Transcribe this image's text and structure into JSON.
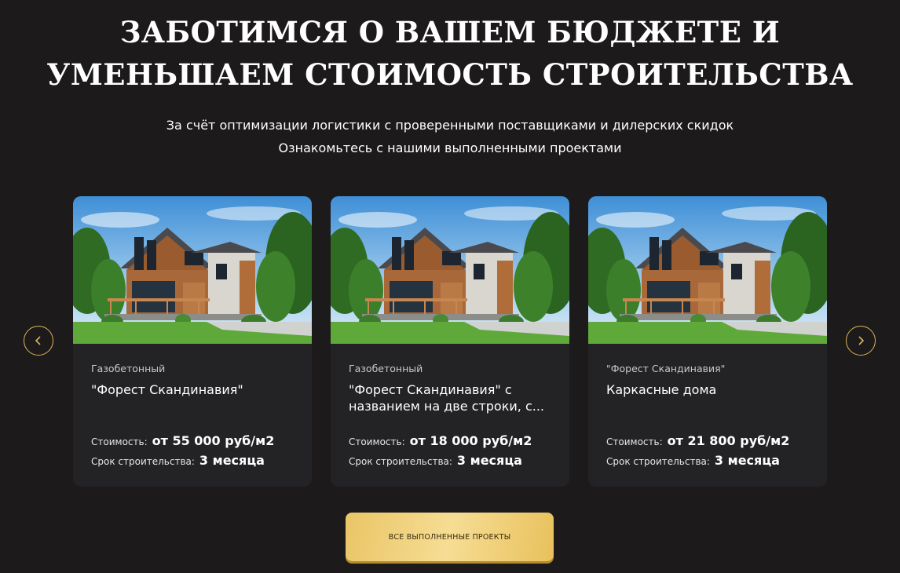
{
  "header": {
    "title_line1": "ЗАБОТИМСЯ О ВАШЕМ БЮДЖЕТЕ И",
    "title_line2": "УМЕНЬШАЕМ СТОИМОСТЬ СТРОИТЕЛЬСТВА",
    "subtitle_line1": "За счёт оптимизации логистики с проверенными поставщиками и дилерских скидок",
    "subtitle_line2": "Ознакомьтесь с нашими выполненными проектами"
  },
  "carousel": {
    "prev_icon": "chevron-left-icon",
    "next_icon": "chevron-right-icon",
    "accent_color": "#d9b65a",
    "price_label": "Стоимость:",
    "term_label": "Срок строительства:",
    "cards": [
      {
        "category": "Газобетонный",
        "name": "\"Форест Скандинавия\"",
        "price": "от 55 000 руб/м2",
        "term": "3 месяца"
      },
      {
        "category": "Газобетонный",
        "name": "\"Форест Скандинавия\" с названием на две строки, с...",
        "price": "от 18 000 руб/м2",
        "term": "3 месяца"
      },
      {
        "category": "\"Форест Скандинавия\"",
        "name": "Каркасные дома",
        "price": "от 21 800 руб/м2",
        "term": "3 месяца"
      }
    ]
  },
  "cta": {
    "label": "ВСЕ ВЫПОЛНЕННЫЕ ПРОЕКТЫ",
    "color": "#f0d27f"
  }
}
